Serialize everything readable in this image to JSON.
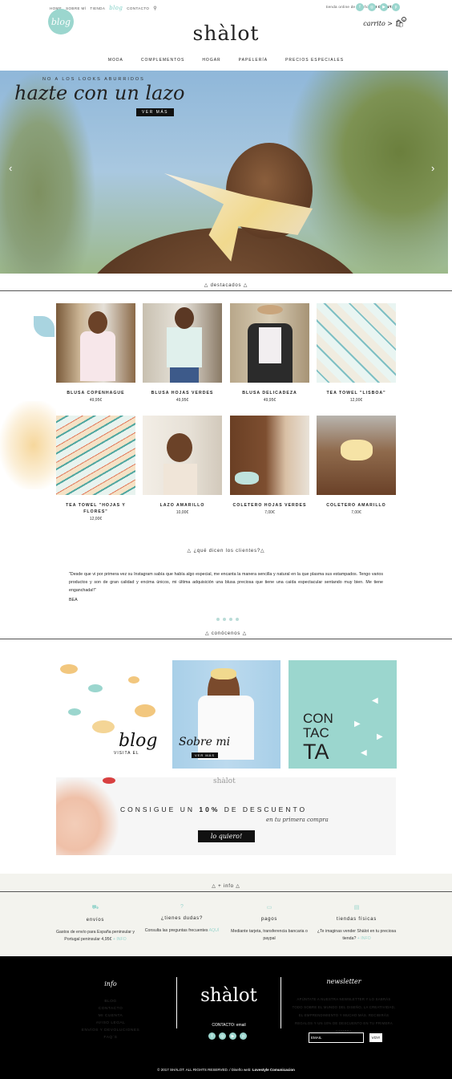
{
  "topbar": {
    "nav": [
      "HOME",
      "SOBRE MÍ",
      "TIENDA"
    ],
    "blog_word": "blog",
    "contact": "CONTACTO",
    "tagline": "tienda online de diseño",
    "account": "MI CUENTA",
    "social": [
      "facebook-icon",
      "instagram-icon",
      "youtube-icon",
      "pinterest-icon"
    ]
  },
  "blog_badge": "blog",
  "logo": "shàlot",
  "cart": {
    "label": "carrito",
    "count": "0"
  },
  "mainnav": [
    "MODA",
    "COMPLEMENTOS",
    "HOGAR",
    "PAPELERÍA",
    "PRECIOS ESPECIALES"
  ],
  "hero": {
    "tagline": "NO A LOS LOOKS ABURRIDOS",
    "heading": "hazte con un lazo",
    "button": "VER MÁS"
  },
  "featured_title": "destacados",
  "products": [
    {
      "name": "BLUSA COPENHAGUE",
      "price": "49,95€"
    },
    {
      "name": "BLUSA HOJAS VERDES",
      "price": "49,95€"
    },
    {
      "name": "BLUSA DELICADEZA",
      "price": "49,95€"
    },
    {
      "name": "TEA TOWEL \"LISBOA\"",
      "price": "12,00€"
    },
    {
      "name": "TEA TOWEL \"HOJAS Y FLORES\"",
      "price": "12,00€"
    },
    {
      "name": "LAZO AMARILLO",
      "price": "10,00€"
    },
    {
      "name": "COLETERO HOJAS VERDES",
      "price": "7,00€"
    },
    {
      "name": "COLETERO AMARILLO",
      "price": "7,00€"
    }
  ],
  "testimonials": {
    "title": "¿qué dicen los clientes?",
    "quote": "\"Desde que vi por primera vez su Instagram sabía que había algo especial, me encanta la manera sencilla y natural en la que plasma sus estampados. Tengo varios productos y son de gran calidad y encima únicos, mi última adquisición una blusa preciosa que tiene una caída espectacular sentando muy bien. Me tiene enganchada!!\"",
    "author": "BEA"
  },
  "about": {
    "title": "conócenos",
    "blog_tile": {
      "heading": "blog",
      "sub": "VISITA EL"
    },
    "sobre_tile": {
      "heading": "Sobre mi",
      "button": "VER MÁS"
    },
    "contact_tile": [
      "CON",
      "TAC",
      "TA"
    ]
  },
  "promo": {
    "brand": "shàlot",
    "headline_pre": "CONSIGUE UN",
    "headline_pct": "10%",
    "headline_post": "DE DESCUENTO",
    "sub": "en tu primera compra",
    "button": "lo quiero!"
  },
  "info": {
    "title": "+ info",
    "cols": [
      {
        "icon": "truck-icon",
        "heading": "envíos",
        "text": "Gastos de envío para España peninsular y Portugal peninsular 4,95€",
        "link": "+ INFO"
      },
      {
        "icon": "question-icon",
        "heading": "¿tienes dudas?",
        "text": "Consulta las preguntas frecuentes",
        "link": "AQUÍ"
      },
      {
        "icon": "card-icon",
        "heading": "pagos",
        "text": "Mediante tarjeta, transferencia bancaria o paypal",
        "link": ""
      },
      {
        "icon": "store-icon",
        "heading": "tiendas físicas",
        "text": "¿Te imaginas vender Shàlot en tu preciosa tienda?",
        "link": "+ INFO"
      }
    ]
  },
  "footer": {
    "info_title": "info",
    "links": [
      "BLOG",
      "CONTACTO",
      "MI CUENTA",
      "AVISO LEGAL",
      "ENVÍOS Y DEVOLUCIONES",
      "FAQ´s"
    ],
    "logo": "shàlot",
    "contact": "CONTACTO: email",
    "newsletter_title": "newsletter",
    "newsletter_text": "APÚNTATE A NUESTRA NEWSLETTER Y LO SABRÁS TODO SOBRE EL MUNDO DEL DISEÑO, LA CREATIVIDAD, EL EMPRENDIMIENTO Y MUCHO MÁS. RECIBIRÁS REGALOS Y UN 10% DE DESCUENTO EN TU PRIMERA COMPRA",
    "email_placeholder": "EMAIL",
    "submit": "VOY!",
    "copyright": "© 2017 SHÀLOT. ALL RIGHTS RESERVED. / Diseño web:",
    "credit": "Lovestyle Comunicacion"
  },
  "colors": {
    "accent": "#9bd6ce",
    "dark": "#000000",
    "light_bg": "#f3f3ee"
  }
}
